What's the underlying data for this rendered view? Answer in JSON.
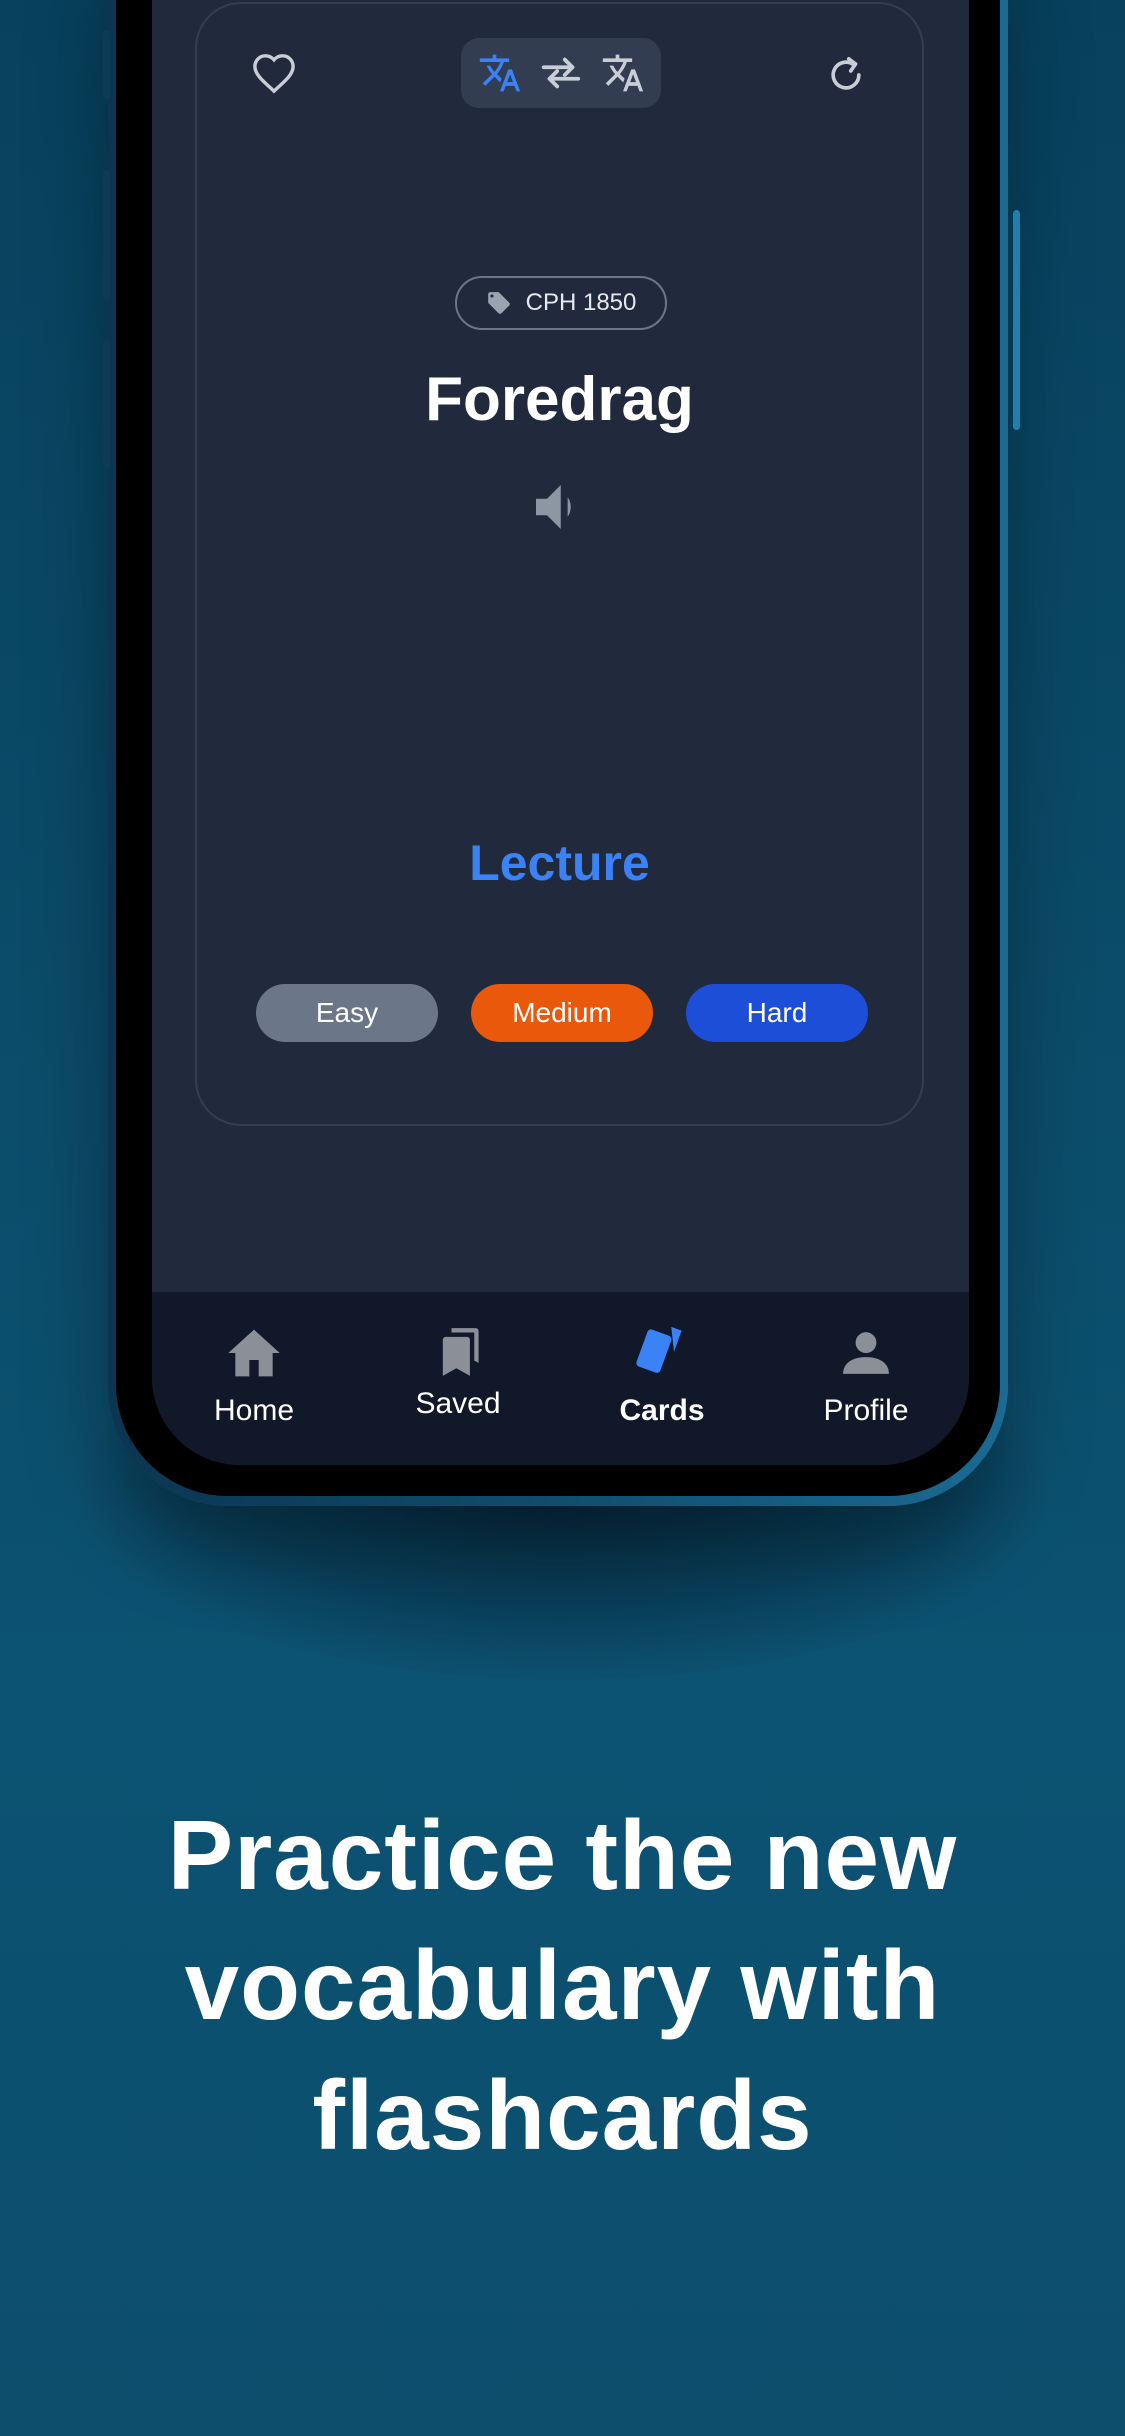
{
  "card": {
    "tag": "CPH 1850",
    "word": "Foredrag",
    "translation": "Lecture",
    "difficulty_buttons": [
      {
        "label": "Easy",
        "color": "#6b7789"
      },
      {
        "label": "Medium",
        "color": "#ea580c"
      },
      {
        "label": "Hard",
        "color": "#1d4ed8"
      }
    ]
  },
  "icons": {
    "favorite": "heart-outline-icon",
    "source_language": "translate-icon",
    "swap": "swap-arrows-icon",
    "target_language": "translate-icon",
    "refresh": "refresh-icon",
    "tag": "tag-icon",
    "audio": "speaker-icon"
  },
  "tabbar": {
    "tabs": [
      {
        "label": "Home",
        "icon": "home-icon",
        "active": false
      },
      {
        "label": "Saved",
        "icon": "bookmarks-icon",
        "active": false
      },
      {
        "label": "Cards",
        "icon": "cards-icon",
        "active": true
      },
      {
        "label": "Profile",
        "icon": "person-icon",
        "active": false
      }
    ]
  },
  "colors": {
    "accent": "#3b82f6",
    "card_bg": "#212a3c",
    "tabbar_bg": "#111829",
    "inactive_icon": "#8a8f98"
  },
  "promo": {
    "headline": "Practice the new vocabulary with flashcards"
  }
}
